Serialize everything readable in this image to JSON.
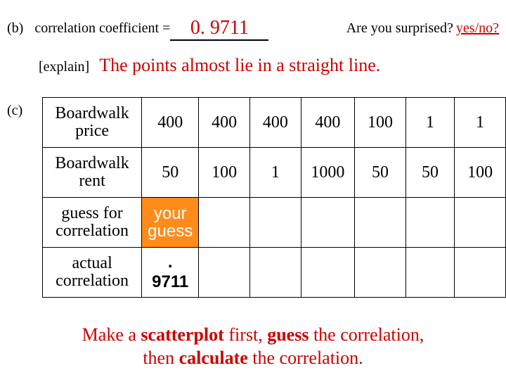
{
  "partB": {
    "label": "(b)",
    "ccLabel": "correlation coefficient = ",
    "ccValue": "0. 9711",
    "surprisedLabel": "Are you surprised? ",
    "yesno": "yes/no?",
    "explainLabel": "[explain]",
    "explainText": "The points almost lie in a straight line."
  },
  "partC": {
    "label": "(c)",
    "rows": {
      "price": {
        "head": "Boardwalk price",
        "cells": [
          "400",
          "400",
          "400",
          "400",
          "100",
          "1",
          "1"
        ]
      },
      "rent": {
        "head": "Boardwalk rent",
        "cells": [
          "50",
          "100",
          "1",
          "1000",
          "50",
          "50",
          "100"
        ]
      },
      "guess": {
        "head": "guess for correlation",
        "special": "your guess"
      },
      "actual": {
        "head": "actual correlation",
        "special": ". 9711"
      }
    }
  },
  "footer": {
    "t1": "Make a ",
    "b1": "scatterplot",
    "t2": " first, ",
    "b2": "guess",
    "t3": " the correlation,",
    "t4": "then ",
    "b3": "calculate",
    "t5": " the correlation."
  }
}
